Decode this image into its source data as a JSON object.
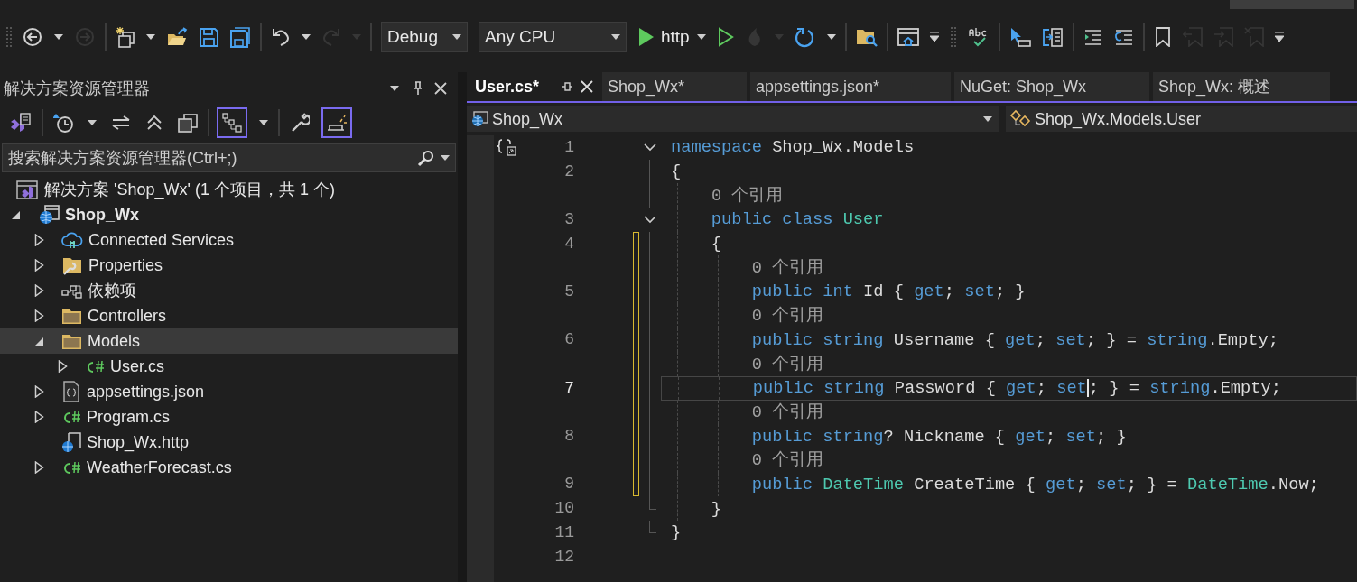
{
  "toolbar": {
    "groups": [
      [
        {
          "kind": "back",
          "disabled": false
        },
        {
          "kind": "caret",
          "disabled": false
        },
        {
          "kind": "forward",
          "disabled": true
        }
      ],
      [
        {
          "kind": "new-item",
          "disabled": false
        },
        {
          "kind": "caret",
          "disabled": false
        },
        {
          "kind": "open",
          "disabled": false
        },
        {
          "kind": "save",
          "disabled": false
        },
        {
          "kind": "save-all",
          "disabled": false
        }
      ],
      [
        {
          "kind": "undo",
          "disabled": false
        },
        {
          "kind": "caret",
          "disabled": false
        },
        {
          "kind": "redo",
          "disabled": true
        },
        {
          "kind": "caret",
          "disabled": true
        }
      ],
      [
        {
          "kind": "dropdown",
          "text": "Debug",
          "disabled": false
        },
        {
          "kind": "dropdown-wide",
          "text": "Any CPU",
          "disabled": false
        },
        {
          "kind": "run",
          "text": "http",
          "disabled": false
        },
        {
          "kind": "run-outline",
          "disabled": false
        },
        {
          "kind": "flame",
          "disabled": true
        },
        {
          "kind": "caret",
          "disabled": true
        },
        {
          "kind": "restart",
          "disabled": false
        },
        {
          "kind": "caret",
          "disabled": false
        }
      ],
      [
        {
          "kind": "folder-search",
          "disabled": false
        }
      ],
      [
        {
          "kind": "browser",
          "disabled": false
        },
        {
          "kind": "overflow",
          "disabled": false
        },
        {
          "kind": "grip",
          "disabled": false
        },
        {
          "kind": "spell",
          "disabled": false
        }
      ],
      [
        {
          "kind": "select",
          "disabled": false
        },
        {
          "kind": "compare",
          "disabled": false
        }
      ],
      [
        {
          "kind": "indent",
          "disabled": false
        },
        {
          "kind": "outdent",
          "disabled": false
        }
      ],
      [
        {
          "kind": "bookmark",
          "disabled": false
        },
        {
          "kind": "bookmark-prev",
          "disabled": true
        },
        {
          "kind": "bookmark-next",
          "disabled": true
        },
        {
          "kind": "bookmark-clear",
          "disabled": true
        },
        {
          "kind": "overflow",
          "disabled": false
        }
      ]
    ]
  },
  "explorer": {
    "title": "解决方案资源管理器",
    "tools": [
      [
        {
          "kind": "vs",
          "on": false
        }
      ],
      [
        {
          "kind": "history",
          "on": false
        },
        {
          "kind": "caret",
          "on": false
        },
        {
          "kind": "sync",
          "on": false
        },
        {
          "kind": "collapse",
          "on": false
        },
        {
          "kind": "copies",
          "on": false
        }
      ],
      [
        {
          "kind": "tree",
          "on": true
        },
        {
          "kind": "caret",
          "on": false
        }
      ],
      [
        {
          "kind": "wrench",
          "on": false
        },
        {
          "kind": "preview",
          "on": true
        }
      ]
    ],
    "search": {
      "placeholder": "搜索解决方案资源管理器(Ctrl+;)"
    },
    "solution": {
      "label": "解决方案 'Shop_Wx' (1 个项目，共 1 个)",
      "children": [
        {
          "label": "Shop_Wx",
          "kind": "web-project",
          "bold": true,
          "expandable": true,
          "expanded": true,
          "selected": false,
          "children": [
            {
              "label": "Connected Services",
              "kind": "cloud",
              "bold": false,
              "expandable": true,
              "expanded": false,
              "selected": false
            },
            {
              "label": "Properties",
              "kind": "properties",
              "bold": false,
              "expandable": true,
              "expanded": false,
              "selected": false
            },
            {
              "label": "依赖项",
              "kind": "dependencies",
              "bold": false,
              "expandable": true,
              "expanded": false,
              "selected": false
            },
            {
              "label": "Controllers",
              "kind": "folder",
              "bold": false,
              "expandable": true,
              "expanded": false,
              "selected": false
            },
            {
              "label": "Models",
              "kind": "folder",
              "bold": false,
              "expandable": true,
              "expanded": true,
              "selected": true,
              "children": [
                {
                  "label": "User.cs",
                  "kind": "csharp",
                  "bold": false,
                  "expandable": true,
                  "expanded": false,
                  "selected": false
                }
              ]
            },
            {
              "label": "appsettings.json",
              "kind": "json",
              "bold": false,
              "expandable": true,
              "expanded": false,
              "selected": false
            },
            {
              "label": "Program.cs",
              "kind": "csharp",
              "bold": false,
              "expandable": true,
              "expanded": false,
              "selected": false
            },
            {
              "label": "Shop_Wx.http",
              "kind": "http",
              "bold": false,
              "expandable": false,
              "selected": false
            },
            {
              "label": "WeatherForecast.cs",
              "kind": "csharp",
              "bold": false,
              "expandable": true,
              "expanded": false,
              "selected": false
            }
          ]
        }
      ]
    }
  },
  "editor": {
    "tabs": [
      {
        "label": "User.cs*",
        "selected": true
      },
      {
        "label": "Shop_Wx*",
        "selected": false
      },
      {
        "label": "appsettings.json*",
        "selected": false
      },
      {
        "label": "NuGet: Shop_Wx",
        "selected": false
      },
      {
        "label": "Shop_Wx: 概述",
        "selected": false
      }
    ],
    "nav": {
      "project": "Shop_Wx",
      "member": "Shop_Wx.Models.User"
    },
    "rows": [
      {
        "kind": "code",
        "number": "1",
        "collapsible": true,
        "in_fold": false,
        "fold_end": false,
        "changed": false,
        "current": false,
        "tokens": [
          {
            "text": "namespace",
            "kind": "keyword"
          },
          {
            "text": " Shop_Wx.Models",
            "kind": "plain"
          }
        ]
      },
      {
        "kind": "code",
        "number": "2",
        "collapsible": false,
        "in_fold": true,
        "fold_end": false,
        "changed": false,
        "current": false,
        "tokens": [
          {
            "text": "{",
            "kind": "plain"
          }
        ]
      },
      {
        "kind": "codelens",
        "text": "0 个引用",
        "collapsible": false,
        "in_fold": true,
        "fold_end": false,
        "changed": false
      },
      {
        "kind": "code",
        "number": "3",
        "collapsible": true,
        "in_fold": true,
        "fold_end": false,
        "changed": false,
        "current": false,
        "tokens": [
          {
            "text": "    public class",
            "kind": "keyword"
          },
          {
            "text": " User",
            "kind": "type"
          }
        ]
      },
      {
        "kind": "code",
        "number": "4",
        "collapsible": false,
        "in_fold": true,
        "fold_end": false,
        "changed": true,
        "current": false,
        "tokens": [
          {
            "text": "    {",
            "kind": "plain"
          }
        ]
      },
      {
        "kind": "codelens",
        "text": "0 个引用",
        "collapsible": false,
        "in_fold": true,
        "fold_end": false,
        "changed": true
      },
      {
        "kind": "code",
        "number": "5",
        "collapsible": false,
        "in_fold": true,
        "fold_end": false,
        "changed": true,
        "current": false,
        "tokens": [
          {
            "text": "        public int",
            "kind": "keyword"
          },
          {
            "text": " Id { ",
            "kind": "plain"
          },
          {
            "text": "get",
            "kind": "keyword"
          },
          {
            "text": "; ",
            "kind": "plain"
          },
          {
            "text": "set",
            "kind": "keyword"
          },
          {
            "text": "; }",
            "kind": "plain"
          }
        ]
      },
      {
        "kind": "codelens",
        "text": "0 个引用",
        "collapsible": false,
        "in_fold": true,
        "fold_end": false,
        "changed": true
      },
      {
        "kind": "code",
        "number": "6",
        "collapsible": false,
        "in_fold": true,
        "fold_end": false,
        "changed": true,
        "current": false,
        "tokens": [
          {
            "text": "        public string",
            "kind": "keyword"
          },
          {
            "text": " Username { ",
            "kind": "plain"
          },
          {
            "text": "get",
            "kind": "keyword"
          },
          {
            "text": "; ",
            "kind": "plain"
          },
          {
            "text": "set",
            "kind": "keyword"
          },
          {
            "text": "; } = ",
            "kind": "plain"
          },
          {
            "text": "string",
            "kind": "keyword"
          },
          {
            "text": ".Empty;",
            "kind": "plain"
          }
        ]
      },
      {
        "kind": "codelens",
        "text": "0 个引用",
        "collapsible": false,
        "in_fold": true,
        "fold_end": false,
        "changed": true
      },
      {
        "kind": "code",
        "number": "7",
        "collapsible": false,
        "in_fold": true,
        "fold_end": false,
        "changed": true,
        "current": true,
        "tokens": [
          {
            "text": "        public string",
            "kind": "keyword"
          },
          {
            "text": " Password { ",
            "kind": "plain"
          },
          {
            "text": "get",
            "kind": "keyword"
          },
          {
            "text": "; ",
            "kind": "plain"
          },
          {
            "text": "set",
            "kind": "keyword",
            "caret": true
          },
          {
            "text": "; } = ",
            "kind": "plain"
          },
          {
            "text": "string",
            "kind": "keyword"
          },
          {
            "text": ".Empty;",
            "kind": "plain"
          }
        ]
      },
      {
        "kind": "codelens",
        "text": "0 个引用",
        "collapsible": false,
        "in_fold": true,
        "fold_end": false,
        "changed": true
      },
      {
        "kind": "code",
        "number": "8",
        "collapsible": false,
        "in_fold": true,
        "fold_end": false,
        "changed": true,
        "current": false,
        "tokens": [
          {
            "text": "        public string",
            "kind": "keyword"
          },
          {
            "text": "? Nickname { ",
            "kind": "plain"
          },
          {
            "text": "get",
            "kind": "keyword"
          },
          {
            "text": "; ",
            "kind": "plain"
          },
          {
            "text": "set",
            "kind": "keyword"
          },
          {
            "text": "; }",
            "kind": "plain"
          }
        ]
      },
      {
        "kind": "codelens",
        "text": "0 个引用",
        "collapsible": false,
        "in_fold": true,
        "fold_end": false,
        "changed": true
      },
      {
        "kind": "code",
        "number": "9",
        "collapsible": false,
        "in_fold": true,
        "fold_end": false,
        "changed": true,
        "current": false,
        "tokens": [
          {
            "text": "        public",
            "kind": "keyword"
          },
          {
            "text": " DateTime",
            "kind": "type"
          },
          {
            "text": " CreateTime { ",
            "kind": "plain"
          },
          {
            "text": "get",
            "kind": "keyword"
          },
          {
            "text": "; ",
            "kind": "plain"
          },
          {
            "text": "set",
            "kind": "keyword"
          },
          {
            "text": "; } = ",
            "kind": "plain"
          },
          {
            "text": "DateTime",
            "kind": "type"
          },
          {
            "text": ".Now;",
            "kind": "plain"
          }
        ]
      },
      {
        "kind": "code",
        "number": "10",
        "collapsible": false,
        "in_fold": true,
        "fold_end": true,
        "changed": false,
        "current": false,
        "tokens": [
          {
            "text": "    }",
            "kind": "plain"
          }
        ]
      },
      {
        "kind": "code",
        "number": "11",
        "collapsible": false,
        "in_fold": true,
        "fold_end": true,
        "changed": false,
        "current": false,
        "tokens": [
          {
            "text": "}",
            "kind": "plain"
          }
        ]
      },
      {
        "kind": "code",
        "number": "12",
        "collapsible": false,
        "in_fold": false,
        "fold_end": false,
        "changed": false,
        "current": false,
        "tokens": []
      }
    ]
  }
}
